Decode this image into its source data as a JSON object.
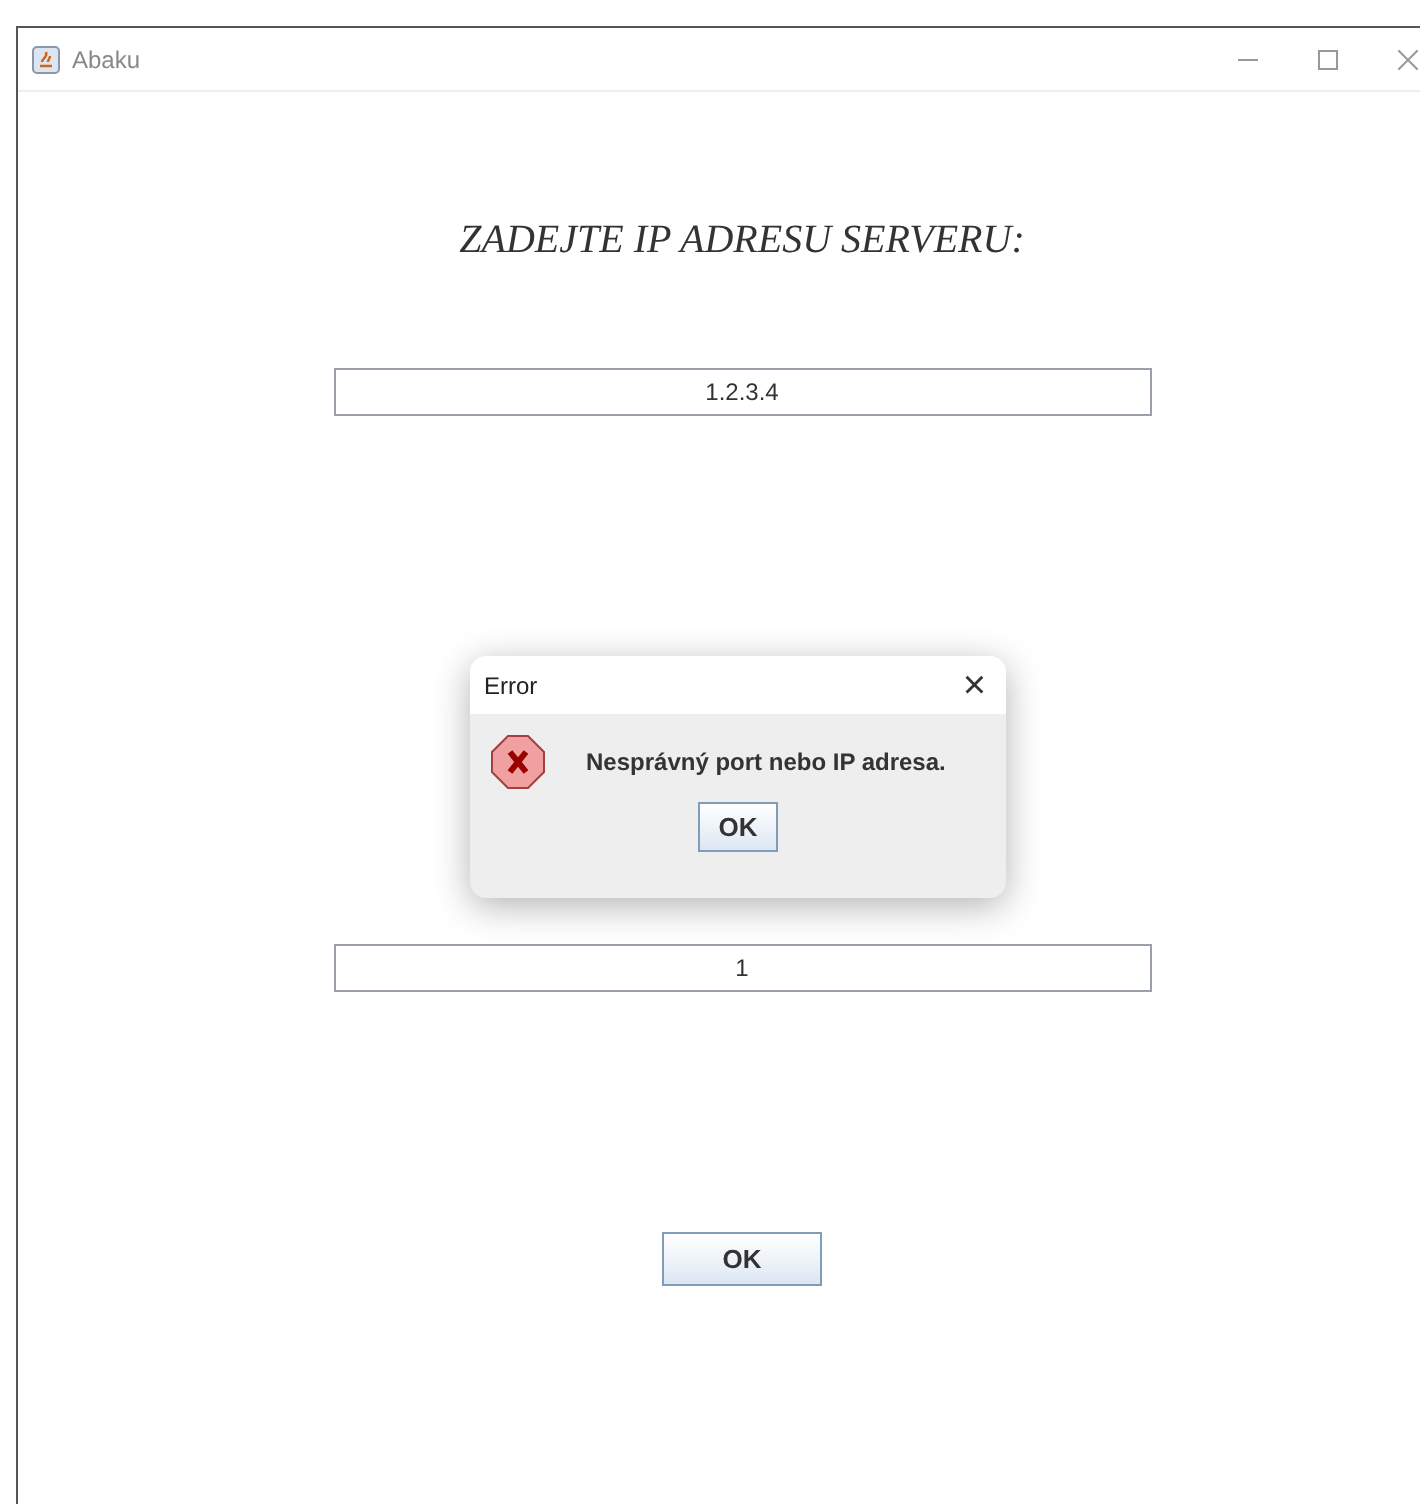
{
  "window": {
    "title": "Abaku"
  },
  "heading": "ZADEJTE IP ADRESU SERVERU:",
  "fields": [
    {
      "value": "1.2.3.4"
    },
    {
      "value": "1"
    }
  ],
  "ok_button": "OK",
  "dialog": {
    "title": "Error",
    "close": "×",
    "message": "Nesprávný port nebo IP adresa.",
    "button": "OK"
  }
}
